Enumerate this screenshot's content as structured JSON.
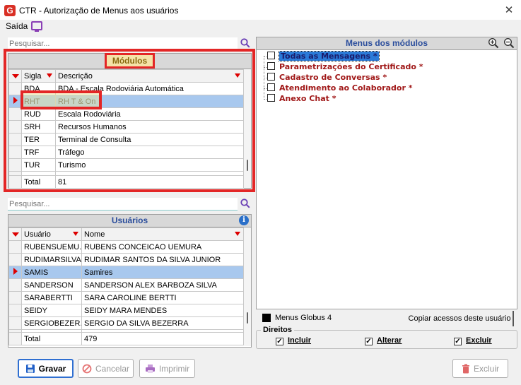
{
  "window": {
    "title": "CTR - Autorização de Menus aos usuários",
    "close_glyph": "✕",
    "app_icon_letter": "G"
  },
  "menu": {
    "saida": "Saída"
  },
  "modules": {
    "search_placeholder": "Pesquisar...",
    "header": "Módulos",
    "columns": {
      "sigla": "Sigla",
      "descricao": "Descrição"
    },
    "rows": [
      {
        "sigla": "BDA",
        "descricao": "BDA - Escala Rodoviária Automática"
      },
      {
        "sigla": "RHT",
        "descricao": "RH T & On"
      },
      {
        "sigla": "RUD",
        "descricao": "Escala Rodoviária"
      },
      {
        "sigla": "SRH",
        "descricao": "Recursos Humanos"
      },
      {
        "sigla": "TER",
        "descricao": "Terminal de Consulta"
      },
      {
        "sigla": "TRF",
        "descricao": "Tráfego"
      },
      {
        "sigla": "TUR",
        "descricao": "Turismo"
      }
    ],
    "total_label": "Total",
    "total_value": "81"
  },
  "users": {
    "search_placeholder": "Pesquisar...",
    "header": "Usuários",
    "columns": {
      "usuario": "Usuário",
      "nome": "Nome"
    },
    "rows": [
      {
        "usuario": "RUBENSUEMU...",
        "nome": "RUBENS CONCEICAO UEMURA"
      },
      {
        "usuario": "RUDIMARSILVA",
        "nome": "RUDIMAR SANTOS DA SILVA JUNIOR"
      },
      {
        "usuario": "SAMIS",
        "nome": "Samires"
      },
      {
        "usuario": "SANDERSON",
        "nome": "SANDERSON ALEX BARBOZA SILVA"
      },
      {
        "usuario": "SARABERTTI",
        "nome": "SARA CAROLINE BERTTI"
      },
      {
        "usuario": "SEIDY",
        "nome": "SEIDY MARA MENDES"
      },
      {
        "usuario": "SERGIOBEZER...",
        "nome": "SERGIO DA SILVA BEZERRA"
      }
    ],
    "total_label": "Total",
    "total_value": "479"
  },
  "menus_panel": {
    "header": "Menus dos módulos",
    "items": [
      "Todas as Mensagens *",
      "Parametrizações do Certificado *",
      "Cadastro de Conversas *",
      "Atendimento ao Colaborador *",
      "Anexo Chat *"
    ]
  },
  "legend": {
    "label": "Menus Globus 4",
    "copy_button": "Copiar acessos deste usuário"
  },
  "direitos": {
    "title": "Direitos",
    "incluir": "Incluir",
    "alterar": "Alterar",
    "excluir": "Excluir"
  },
  "buttons": {
    "gravar": "Gravar",
    "cancelar": "Cancelar",
    "imprimir": "Imprimir",
    "excluir": "Excluir"
  },
  "colors": {
    "accent_header": "#2a4d9c",
    "highlight_red": "#e32626",
    "selected_row": "#a8c8ee",
    "menu_item": "#a01818"
  }
}
